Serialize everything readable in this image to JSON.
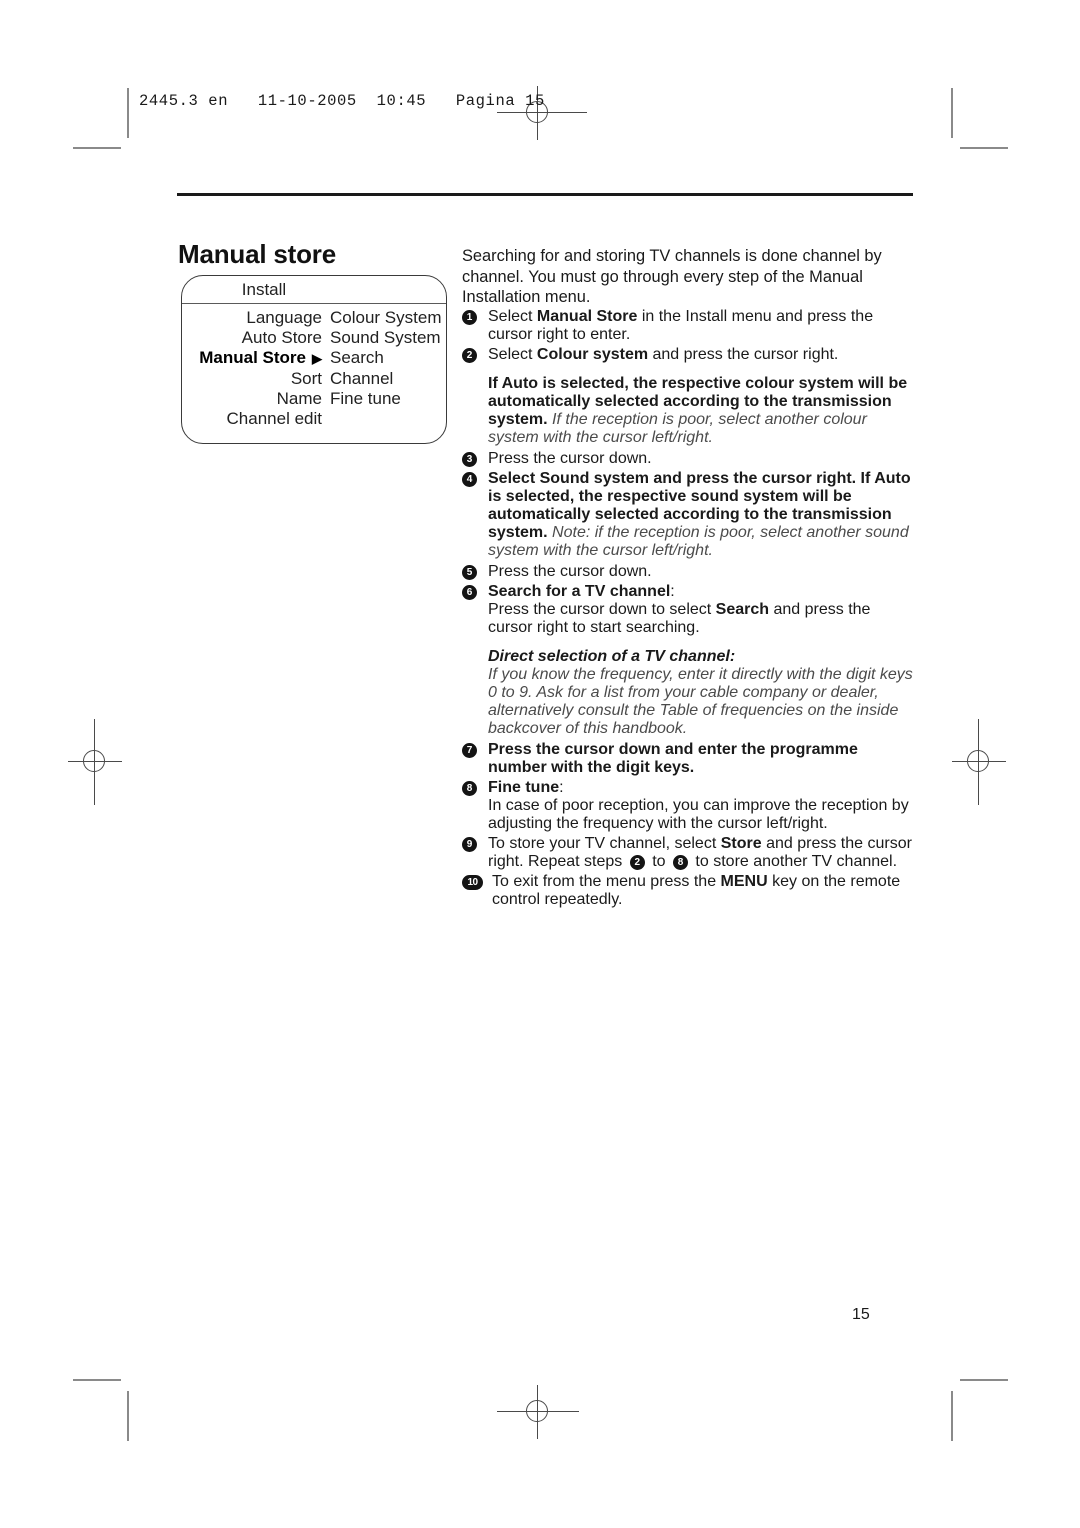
{
  "printer": {
    "slug": "2445.3 en   11-10-2005  10:45   Pagina 15"
  },
  "page": {
    "title": "Manual store",
    "number": "15"
  },
  "osd_menu": {
    "header": "Install",
    "rows": [
      {
        "left": "Language",
        "right": "Colour System",
        "selected": false
      },
      {
        "left": "Auto Store",
        "right": "Sound System",
        "selected": false
      },
      {
        "left": "Manual Store",
        "right": "Search",
        "selected": true,
        "arrow": "▶"
      },
      {
        "left": "Sort",
        "right": "Channel",
        "selected": false
      },
      {
        "left": "Name",
        "right": "Fine tune",
        "selected": false
      },
      {
        "left": "Channel edit",
        "right": "",
        "selected": false
      }
    ]
  },
  "instructions": {
    "intro": "Searching for and storing TV channels is done channel by channel. You must go through every step of the Manual Installation menu.",
    "step1": {
      "badge": "1",
      "a": "Select ",
      "bold": "Manual Store",
      "b": " in the Install menu and press the cursor right to enter."
    },
    "step2": {
      "badge": "2",
      "a": "Select ",
      "bold": "Colour system",
      "b": " and press the cursor right."
    },
    "note_colour": {
      "a": "If ",
      "bold": "Auto",
      "b": " is selected, the respective colour system will be automatically selected according to the transmission system.",
      "italic": "If the reception is poor, select another colour system with the cursor left/right."
    },
    "step3": {
      "badge": "3",
      "text": "Press the cursor down."
    },
    "step4": {
      "badge": "4",
      "a": "Select ",
      "bold1": "Sound system",
      "b": " and press the cursor right. If ",
      "bold2": "Auto",
      "c": " is selected, the respective sound system will be automatically selected according to the transmission system.",
      "italic": "Note: if the reception is poor, select another sound system with the cursor left/right."
    },
    "step5": {
      "badge": "5",
      "text": "Press the cursor down."
    },
    "step6": {
      "badge": "6",
      "heading": "Search for a TV channel",
      "colon": ":",
      "a": "Press the cursor down to select ",
      "bold": "Search",
      "b": " and press the cursor right to start searching."
    },
    "direct": {
      "heading": "Direct selection of a TV channel:",
      "body": "If you know the frequency, enter it directly with the digit keys 0 to 9. Ask for a list from your cable company or dealer, alternatively consult the Table of frequencies on the inside backcover of this handbook."
    },
    "step7": {
      "badge": "7",
      "text": "Press the cursor down and enter the programme number with the digit keys."
    },
    "step8": {
      "badge": "8",
      "heading": "Fine tune",
      "colon": ":",
      "body": "In case of poor reception, you can improve the reception by adjusting the frequency with the cursor left/right."
    },
    "step9": {
      "badge": "9",
      "a": "To store your TV channel, select ",
      "bold": "Store",
      "b": " and press the cursor right. Repeat steps ",
      "ref1": "2",
      "mid": " to ",
      "ref2": "8",
      "c": " to store another TV channel."
    },
    "step10": {
      "badge": "10",
      "a": "To exit from the menu press the ",
      "bold": "MENU",
      "b": " key on the remote control repeatedly."
    }
  }
}
